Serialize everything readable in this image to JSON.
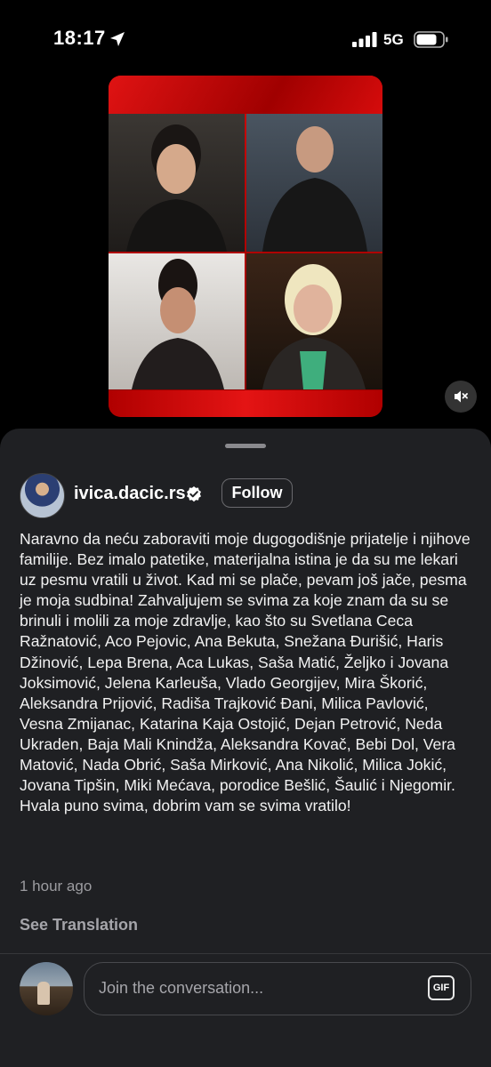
{
  "status_bar": {
    "time": "18:17",
    "network": "5G",
    "icons": [
      "location-arrow-icon",
      "signal-icon",
      "battery-icon"
    ]
  },
  "media": {
    "icons": [
      "speaker-muted-icon"
    ],
    "colors": {
      "frame": "#c80808"
    }
  },
  "post": {
    "username": "ivica.dacic.rs",
    "follow_label": "Follow",
    "caption": "Naravno da neću zaboraviti moje dugogodišnje prijatelje i njihove familije. Bez imalo patetike, materijalna istina je da su me lekari uz pesmu vratili u život. Kad mi se plače, pevam još jače, pesma je moja sudbina! Zahvaljujem se svima za koje znam da su se brinuli i molili za moje zdravlje, kao što su Svetlana Ceca Ražnatović, Aco Pejovic, Ana Bekuta, Snežana Đurišić, Haris Džinović, Lepa Brena, Aca Lukas, Saša Matić, Željko i Jovana Joksimović, Jelena Karleuša, Vlado Georgijev, Mira Škorić, Aleksandra Prijović, Radiša Trajković Đani, Milica Pavlović, Vesna Zmijanac, Katarina Kaja Ostojić, Dejan Petrović, Neda Ukraden, Baja Mali Knindža, Aleksandra Kovač, Bebi Dol, Vera Matović, Nada Obrić, Saša Mirković, Ana Nikolić, Milica Jokić, Jovana Tipšin, Miki Mećava, porodice Bešlić, Šaulić i Njegomir. Hvala puno svima, dobrim vam se svima vratilo!",
    "time_ago": "1 hour ago",
    "see_translation": "See Translation"
  },
  "comment": {
    "placeholder": "Join the conversation...",
    "gif_label": "GIF"
  },
  "colors": {
    "sheet_bg": "#1f2023",
    "verified_badge": "#ffffff"
  }
}
